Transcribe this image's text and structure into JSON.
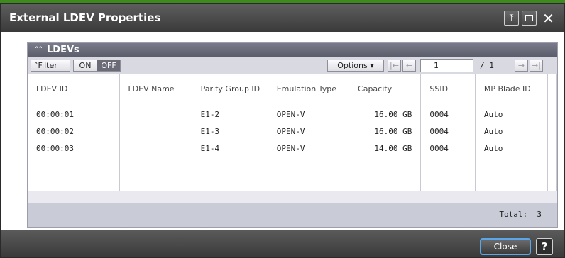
{
  "window": {
    "title": "External LDEV Properties"
  },
  "panel": {
    "title": "LDEVs"
  },
  "toolbar": {
    "filter_label": "Filter",
    "on_label": "ON",
    "off_label": "OFF",
    "options_label": "Options",
    "page_value": "1",
    "page_total": "/ 1"
  },
  "table": {
    "columns": [
      "LDEV ID",
      "LDEV Name",
      "Parity Group ID",
      "Emulation Type",
      "Capacity",
      "SSID",
      "MP Blade ID"
    ],
    "rows": [
      [
        "00:00:01",
        "",
        "E1-2",
        "OPEN-V",
        "16.00 GB",
        "0004",
        "Auto"
      ],
      [
        "00:00:02",
        "",
        "E1-3",
        "OPEN-V",
        "16.00 GB",
        "0004",
        "Auto"
      ],
      [
        "00:00:03",
        "",
        "E1-4",
        "OPEN-V",
        "14.00 GB",
        "0004",
        "Auto"
      ],
      [
        "",
        "",
        "",
        "",
        "",
        "",
        ""
      ],
      [
        "",
        "",
        "",
        "",
        "",
        "",
        ""
      ]
    ],
    "total_label": "Total:",
    "total_value": "3"
  },
  "footer": {
    "close_label": "Close",
    "help_label": "?"
  },
  "icons": {
    "pin": "pin-icon",
    "maximize": "maximize-icon",
    "close": "close-icon",
    "collapse": "collapse-chevron-icon",
    "first": "first-page-icon",
    "prev": "prev-page-icon",
    "next": "next-page-icon",
    "last": "last-page-icon"
  },
  "colors": {
    "title_bar": "#4a4a4a",
    "panel_header": "#6a6c7a",
    "close_focus": "#5aa6e8",
    "top_strip": "#3e8a1d"
  }
}
